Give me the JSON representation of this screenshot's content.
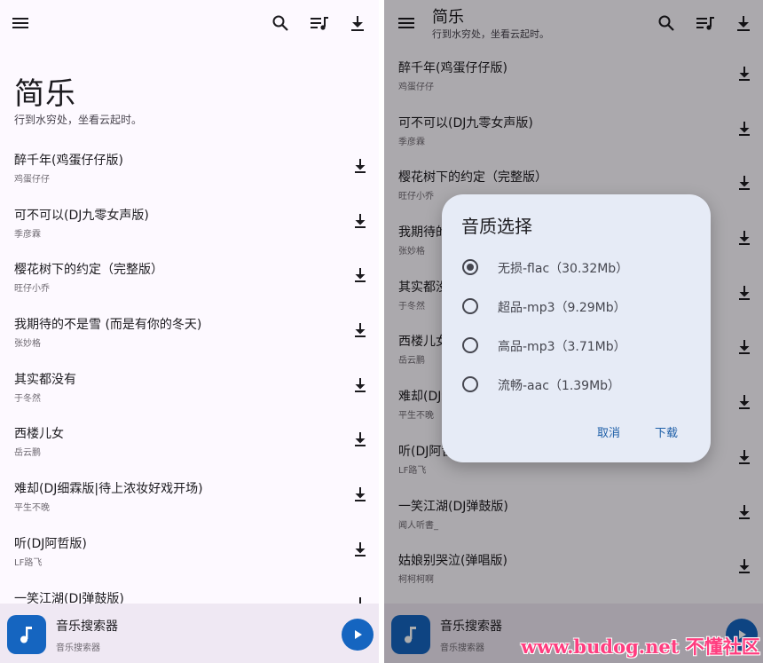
{
  "app": {
    "title": "简乐",
    "subtitle": "行到水穷处，坐看云起时。"
  },
  "icons": {
    "menu": "menu-icon",
    "search": "search-icon",
    "queue": "queue-music-icon",
    "download": "download-icon",
    "music_note": "music-note-icon",
    "play": "play-icon"
  },
  "colors": {
    "accent": "#1565c0",
    "surface": "#fdf9ff",
    "player_bar": "#efe8f3",
    "dialog": "#e6ebf6",
    "dialog_button": "#1e5fa8",
    "watermark": "#ff3d7f"
  },
  "songs_left": [
    {
      "title": "醉千年(鸡蛋仔仔版)",
      "artist": "鸡蛋仔仔"
    },
    {
      "title": "可不可以(DJ九零女声版)",
      "artist": "季彦霖"
    },
    {
      "title": "樱花树下的约定（完整版）",
      "artist": "旺仔小乔"
    },
    {
      "title": "我期待的不是雪 (而是有你的冬天)",
      "artist": "张妙格"
    },
    {
      "title": "其实都没有",
      "artist": "于冬然"
    },
    {
      "title": "西楼儿女",
      "artist": "岳云鹏"
    },
    {
      "title": "难却(DJ细霖版|待上浓妆好戏开场)",
      "artist": "平生不晚"
    },
    {
      "title": "听(DJ阿哲版)",
      "artist": "LF路飞"
    },
    {
      "title": "一笑江湖(DJ弹鼓版)",
      "artist": "闻人听書_"
    }
  ],
  "songs_right": [
    {
      "title": "醉千年(鸡蛋仔仔版)",
      "artist": "鸡蛋仔仔"
    },
    {
      "title": "可不可以(DJ九零女声版)",
      "artist": "季彦霖"
    },
    {
      "title": "樱花树下的约定（完整版）",
      "artist": "旺仔小乔"
    },
    {
      "title": "我期待的不是雪 (而是有你的冬天)",
      "artist": "张妙格"
    },
    {
      "title": "其实都没有",
      "artist": "于冬然"
    },
    {
      "title": "西楼儿女",
      "artist": "岳云鹏"
    },
    {
      "title": "难却(DJ细霖版|待上浓妆好戏开场)",
      "artist": "平生不晚"
    },
    {
      "title": "听(DJ阿哲版)",
      "artist": "LF路飞"
    },
    {
      "title": "一笑江湖(DJ弹鼓版)",
      "artist": "闻人听書_"
    },
    {
      "title": "姑娘别哭泣(弹唱版)",
      "artist": "柯柯柯啊"
    }
  ],
  "player": {
    "title": "音乐搜索器",
    "subtitle": "音乐搜索器"
  },
  "dialog": {
    "title": "音质选择",
    "selected_index": 0,
    "options": [
      {
        "label": "无损-flac（30.32Mb）"
      },
      {
        "label": "超品-mp3（9.29Mb）"
      },
      {
        "label": "高品-mp3（3.71Mb）"
      },
      {
        "label": "流畅-aac（1.39Mb）"
      }
    ],
    "cancel": "取消",
    "confirm": "下载"
  },
  "watermark": "www.budog.net 不懂社区"
}
